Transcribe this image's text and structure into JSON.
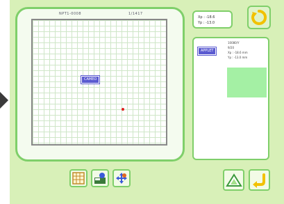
{
  "frame_header": {
    "left_text": "NPT1-0008",
    "right_text": "1/1417"
  },
  "pattern": {
    "label": "CAMEO"
  },
  "coordinates": {
    "line1": "Xp : -18.6",
    "line2": "Yp : -13.0"
  },
  "info": {
    "badge": "APPLET",
    "lines": [
      "10080/Y",
      "9/20",
      "Xp : -18.6 mm",
      "Yp : -13.0 mm"
    ],
    "swatch_color": "#a4f0a4"
  },
  "icons": {
    "rotate": "rotate-icon",
    "grid": "grid-icon",
    "abc_color": "abc-color-icon",
    "move": "move-icon",
    "up": "up-arrow-icon",
    "enter": "enter-icon"
  },
  "colors": {
    "accent": "#7fcf6a",
    "label": "#5a5ad0",
    "marker": "#e02020"
  }
}
